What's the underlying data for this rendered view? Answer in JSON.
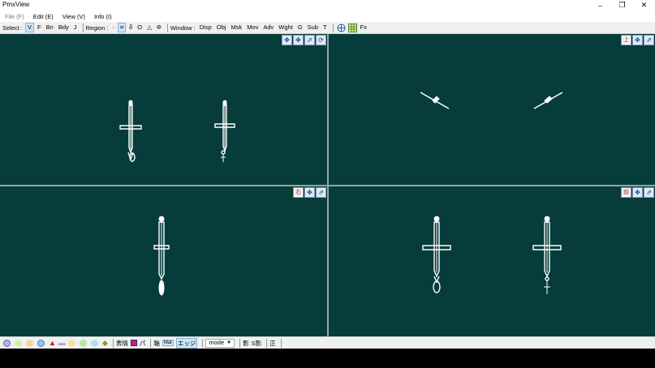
{
  "window": {
    "title": "PmxView"
  },
  "menubar": {
    "items": [
      "File (F)",
      "Edit (E)",
      "View (V)",
      "Info (I)"
    ]
  },
  "toolbar": {
    "select_label": "Select :",
    "select_buttons": [
      "V",
      "F",
      "Bn",
      "Bdy",
      "J"
    ],
    "region_label": "Region :",
    "region_buttons": [
      "·",
      "¤",
      "δ",
      "O",
      "△",
      "Φ"
    ],
    "window_label": "Window :",
    "window_buttons": [
      "Disp",
      "Obj",
      "Msk",
      "Mov",
      "Adv",
      "Wght",
      "G",
      "Sub",
      "T"
    ],
    "fx_label": "Fx"
  },
  "viewports": {
    "top_right_view_label": "上",
    "bottom_left_view_label": "右",
    "bottom_right_view_label": "前"
  },
  "bottombar": {
    "morph_label": "表情",
    "pa_label": "パ",
    "axis_label": "軸",
    "mat_label": "Mat",
    "edge_label": "エッジ",
    "mode_label": "mode",
    "shadow_label": "影",
    "s_shadow_label": "S影",
    "front_label": "正"
  },
  "colors": {
    "viewport_bg": "#063c3a",
    "model": "#ffffff"
  }
}
